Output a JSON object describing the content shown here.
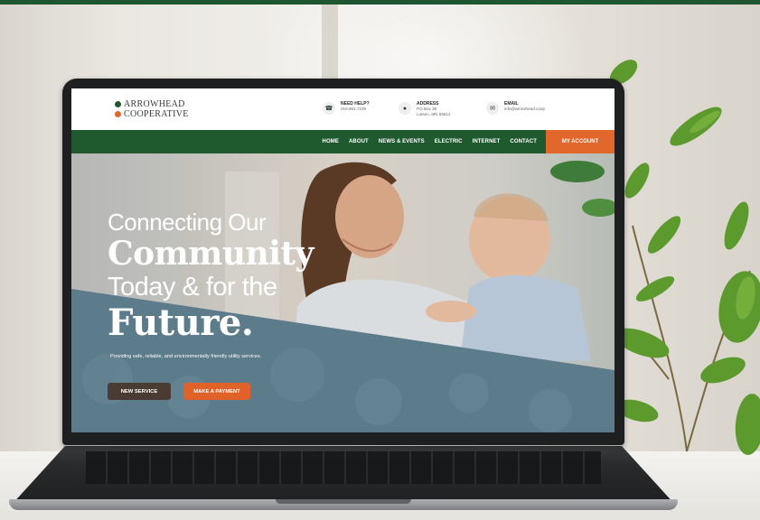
{
  "colors": {
    "brand_green": "#1f5a2f",
    "accent_orange": "#e2672a",
    "hero_slate": "#5c7b8b",
    "button_brown": "#4a3b33"
  },
  "header": {
    "logo": {
      "line1": "ARROWHEAD",
      "line2": "COOPERATIVE"
    },
    "contacts": [
      {
        "icon": "phone-icon",
        "title": "NEED HELP?",
        "lines": [
          "218.863.7239"
        ]
      },
      {
        "icon": "map-pin-icon",
        "title": "ADDRESS",
        "lines": [
          "PO Box 39",
          "Lutsen, MN 55612"
        ]
      },
      {
        "icon": "envelope-icon",
        "title": "EMAIL",
        "lines": [
          "info@arrowhead.coop"
        ]
      }
    ]
  },
  "nav": {
    "items": [
      "HOME",
      "ABOUT",
      "NEWS & EVENTS",
      "ELECTRIC",
      "INTERNET",
      "CONTACT"
    ],
    "account_label": "MY ACCOUNT"
  },
  "hero": {
    "line1": "Connecting Our",
    "line2": "Community",
    "line3": "Today & for the",
    "line4": "Future.",
    "subtitle": "Providing safe, reliable, and environmentally friendly utility services.",
    "buttons": {
      "primary": "NEW SERVICE",
      "secondary": "MAKE A PAYMENT"
    }
  }
}
